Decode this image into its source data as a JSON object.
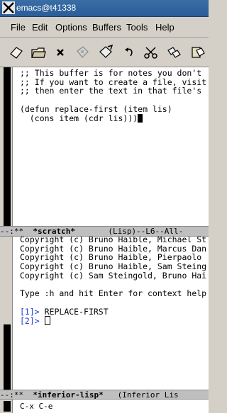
{
  "window": {
    "title": "emacs@t41338"
  },
  "menubar": {
    "items": [
      "File",
      "Edit",
      "Options",
      "Buffers",
      "Tools",
      "Help"
    ]
  },
  "toolbar": {
    "buttons": [
      {
        "name": "new-file-icon"
      },
      {
        "name": "open-folder-icon"
      },
      {
        "name": "close-x-icon"
      },
      {
        "name": "save-disk-icon"
      },
      {
        "name": "save-as-icon"
      },
      {
        "name": "undo-icon"
      },
      {
        "name": "cut-scissors-icon"
      },
      {
        "name": "copy-icon"
      },
      {
        "name": "paste-icon"
      }
    ]
  },
  "scratch": {
    "lines": [
      ";; This buffer is for notes you don't",
      ";; If you want to create a file, visit",
      ";; then enter the text in that file's",
      "",
      "(defun replace-first (item lis)",
      "  (cons item (cdr lis)))"
    ],
    "modeline": {
      "prefix": "--:**  ",
      "buffer": "*scratch*",
      "suffix": "       (Lisp)--L6--All-"
    }
  },
  "inferior": {
    "lines": [
      "Copyright (c) Bruno Haible, Michael St",
      "Copyright (c) Bruno Haible, Marcus Dan",
      "Copyright (c) Bruno Haible, Pierpaolo",
      "Copyright (c) Bruno Haible, Sam Steing",
      "Copyright (c) Sam Steingold, Bruno Hai",
      "",
      "Type :h and hit Enter for context help"
    ],
    "prompt1": "[1]>",
    "output1": " REPLACE-FIRST",
    "prompt2": "[2]>",
    "modeline": {
      "prefix": "--:**  ",
      "buffer": "*inferior-lisp*",
      "suffix": "   (Inferior Lis"
    }
  },
  "minibuffer": {
    "text": "C-x C-e"
  },
  "colors": {
    "prompt": "#1a3ad6",
    "titlebar": "#2b5d99"
  }
}
